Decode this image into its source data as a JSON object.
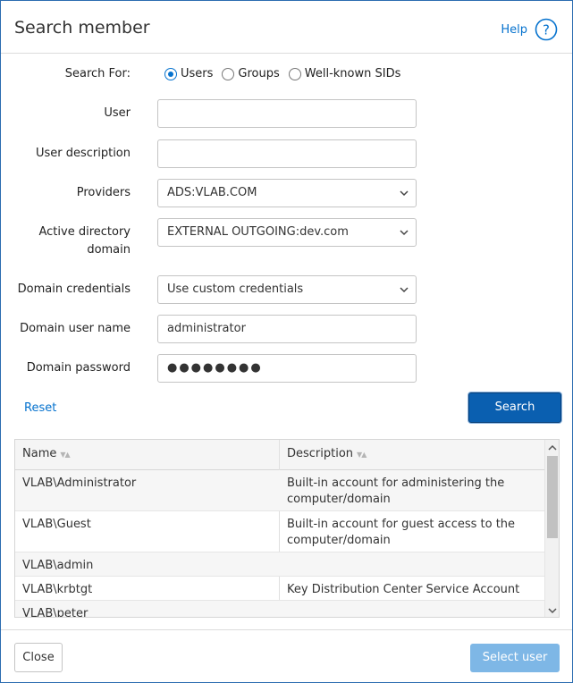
{
  "dialog": {
    "title": "Search member",
    "help_label": "Help"
  },
  "search_for": {
    "label": "Search For:",
    "options": [
      {
        "label": "Users",
        "selected": true
      },
      {
        "label": "Groups",
        "selected": false
      },
      {
        "label": "Well-known SIDs",
        "selected": false
      }
    ]
  },
  "fields": {
    "user": {
      "label": "User",
      "value": ""
    },
    "user_description": {
      "label": "User description",
      "value": ""
    },
    "providers": {
      "label": "Providers",
      "value": "ADS:VLAB.COM"
    },
    "ad_domain": {
      "label_line1": "Active directory",
      "label_line2": "domain",
      "value": "EXTERNAL OUTGOING:dev.com"
    },
    "domain_credentials": {
      "label": "Domain credentials",
      "value": "Use custom credentials"
    },
    "domain_user_name": {
      "label": "Domain user name",
      "value": "administrator"
    },
    "domain_password": {
      "label": "Domain password",
      "value": "●●●●●●●●"
    }
  },
  "actions": {
    "reset_label": "Reset",
    "search_label": "Search"
  },
  "table": {
    "columns": [
      "Name",
      "Description"
    ],
    "rows": [
      {
        "name": "VLAB\\Administrator",
        "description": "Built-in account for administering the computer/domain"
      },
      {
        "name": "VLAB\\Guest",
        "description": "Built-in account for guest access to the computer/domain"
      },
      {
        "name": "VLAB\\admin",
        "description": ""
      },
      {
        "name": "VLAB\\krbtgt",
        "description": "Key Distribution Center Service Account"
      },
      {
        "name": "VLAB\\peter",
        "description": ""
      }
    ]
  },
  "footer": {
    "close_label": "Close",
    "select_user_label": "Select user"
  },
  "colors": {
    "accent": "#0572ce",
    "primary_button": "#0a5fb0",
    "disabled_button": "#7eb7e6"
  }
}
